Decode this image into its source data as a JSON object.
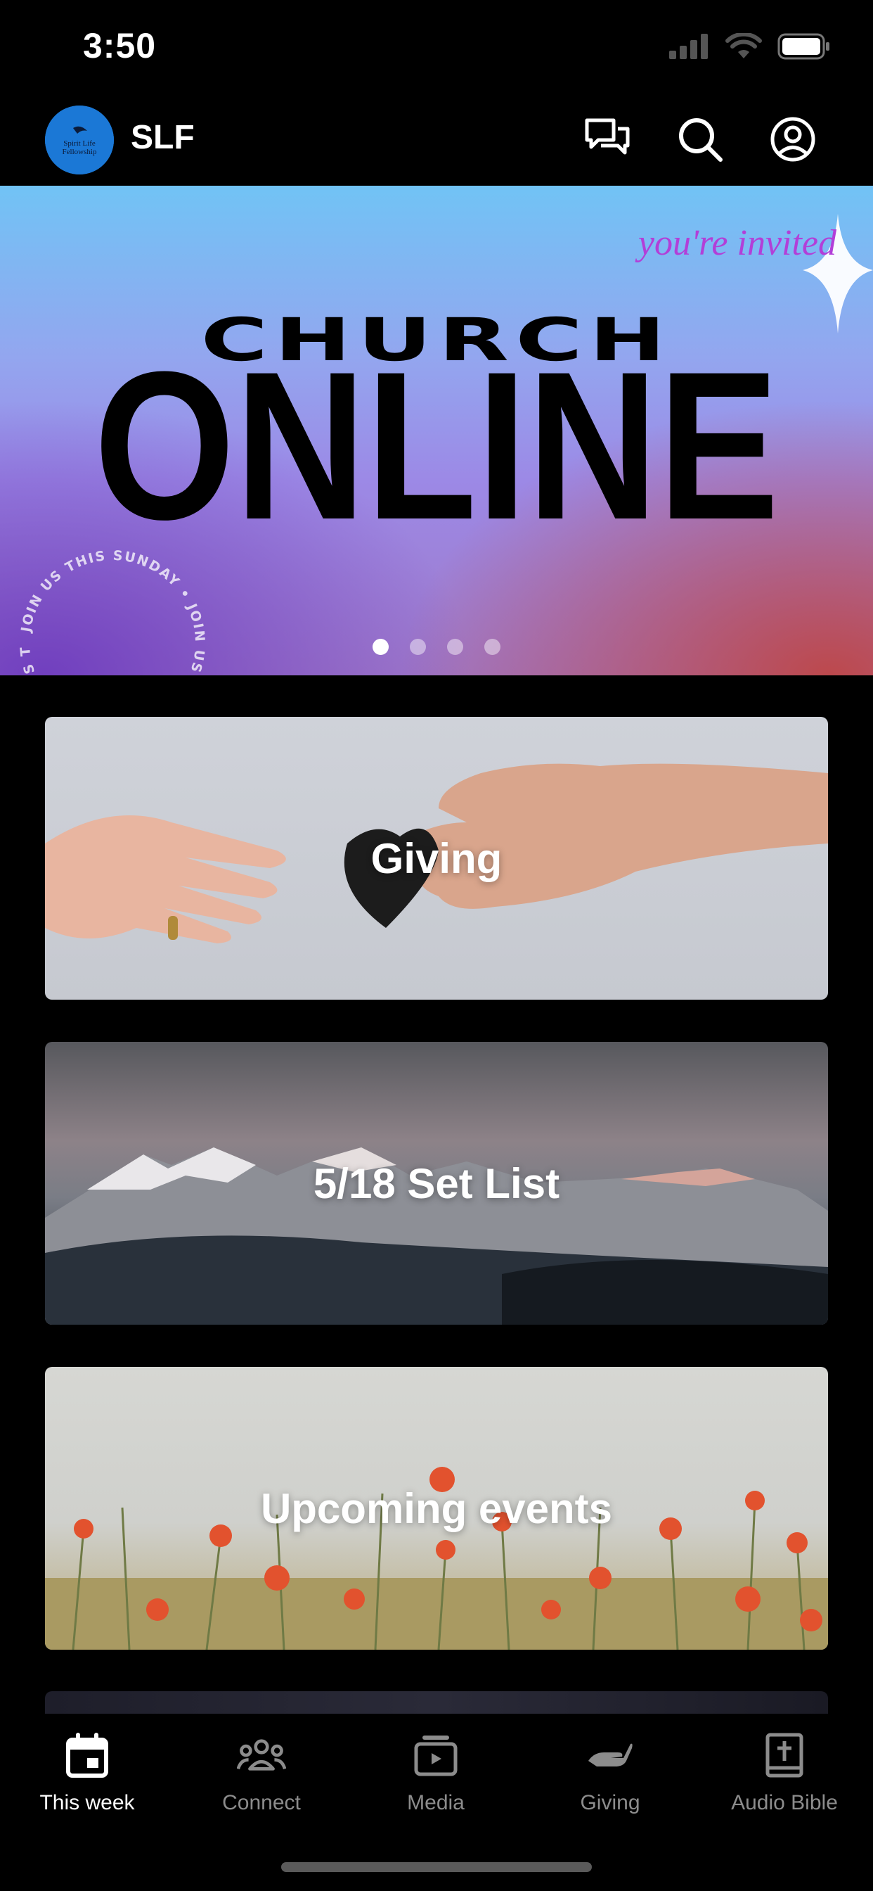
{
  "status_bar": {
    "time": "3:50"
  },
  "header": {
    "logo_text": "Spirit Life Fellowship",
    "title": "SLF",
    "icons": [
      "chat-icon",
      "search-icon",
      "account-icon"
    ]
  },
  "hero": {
    "invited_text": "you're invited",
    "headline_top": "CHURCH",
    "headline_main": "ONLINE",
    "circle_text": "JOIN US THIS SUNDAY • JOIN US THIS SUNDAY • JOIN US THIS SUNDAY •",
    "carousel_dots": 4,
    "carousel_active_index": 0
  },
  "cards": [
    {
      "label": "Giving"
    },
    {
      "label": "5/18 Set List"
    },
    {
      "label": "Upcoming events"
    }
  ],
  "tabs": [
    {
      "label": "This week",
      "icon": "calendar-icon",
      "active": true
    },
    {
      "label": "Connect",
      "icon": "people-icon",
      "active": false
    },
    {
      "label": "Media",
      "icon": "media-icon",
      "active": false
    },
    {
      "label": "Giving",
      "icon": "giving-hand-icon",
      "active": false
    },
    {
      "label": "Audio Bible",
      "icon": "bible-icon",
      "active": false
    }
  ],
  "colors": {
    "accent_logo": "#1b78d6",
    "invited_text": "#b23fd8",
    "tab_inactive": "#8c8c8c"
  }
}
